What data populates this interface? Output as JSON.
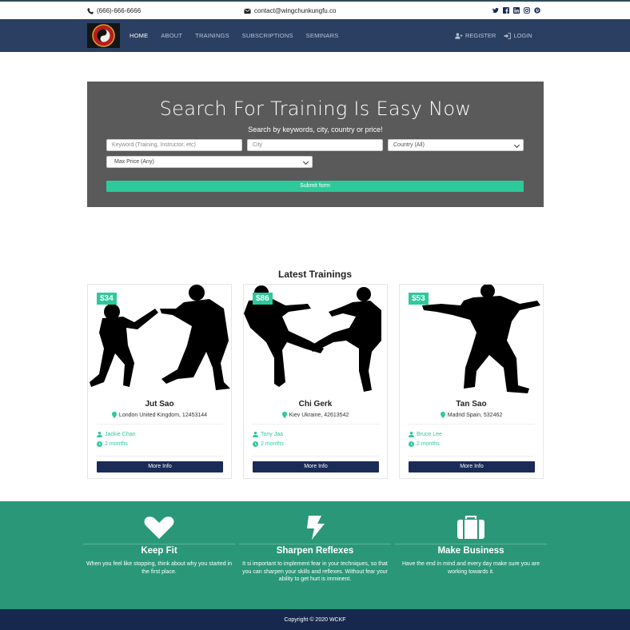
{
  "topbar": {
    "phone": "(666)-666-6666",
    "email": "contact@wingchunkungfu.co",
    "social_icons": [
      "twitter-icon",
      "facebook-icon",
      "linkedin-icon",
      "instagram-icon",
      "pinterest-icon"
    ]
  },
  "nav": {
    "items": [
      {
        "label": "HOME",
        "active": true
      },
      {
        "label": "ABOUT",
        "active": false
      },
      {
        "label": "TRAININGS",
        "active": false
      },
      {
        "label": "SUBSCRIPTIONS",
        "active": false
      },
      {
        "label": "SEMINARS",
        "active": false
      }
    ],
    "register_label": "REGISTER",
    "login_label": "LOGIN"
  },
  "search": {
    "title": "Search For Training Is Easy Now",
    "subtitle": "Search by keywords, city, country or price!",
    "keyword_placeholder": "Keyword (Training, Instructor, etc)",
    "city_placeholder": "City",
    "country_selected": "Country (All)",
    "price_selected": "Max Price (Any)",
    "submit_label": "Submit form"
  },
  "latest": {
    "title": "Latest Trainings",
    "cards": [
      {
        "price": "$34",
        "name": "Jut Sao",
        "location": "London United Kingdom, 12453144",
        "instructor": "Jackie Chan",
        "duration": "2 months",
        "button": "More Info"
      },
      {
        "price": "$86",
        "name": "Chi Gerk",
        "location": "Kiev Ukraine, 42613542",
        "instructor": "Tony Jaa",
        "duration": "2 months",
        "button": "More Info"
      },
      {
        "price": "$53",
        "name": "Tan Sao",
        "location": "Madrid Spain, 532462",
        "instructor": "Bruce Lee",
        "duration": "2 months",
        "button": "More Info"
      }
    ]
  },
  "features": [
    {
      "icon": "heart-icon",
      "title": "Keep Fit",
      "text": "When you feel like stopping, think about why you started in the first place."
    },
    {
      "icon": "lightning-icon",
      "title": "Sharpen Reflexes",
      "text": "It si important to implement fear in your techniques, so that you can sharpen your skills and reflexes. Without fear your ability to get hurt is imminent."
    },
    {
      "icon": "briefcase-icon",
      "title": "Make Business",
      "text": "Have the end in mind and every day make sure you are working towards it."
    }
  ],
  "footer": {
    "copyright": "Copyright © 2020 WCKF"
  },
  "colors": {
    "nav_bg": "#2b3f63",
    "accent": "#2ec99a",
    "features_bg": "#2a9878",
    "footer_bg": "#17284f",
    "button_dark": "#1b2b57",
    "search_bg": "#5a5a5a"
  }
}
